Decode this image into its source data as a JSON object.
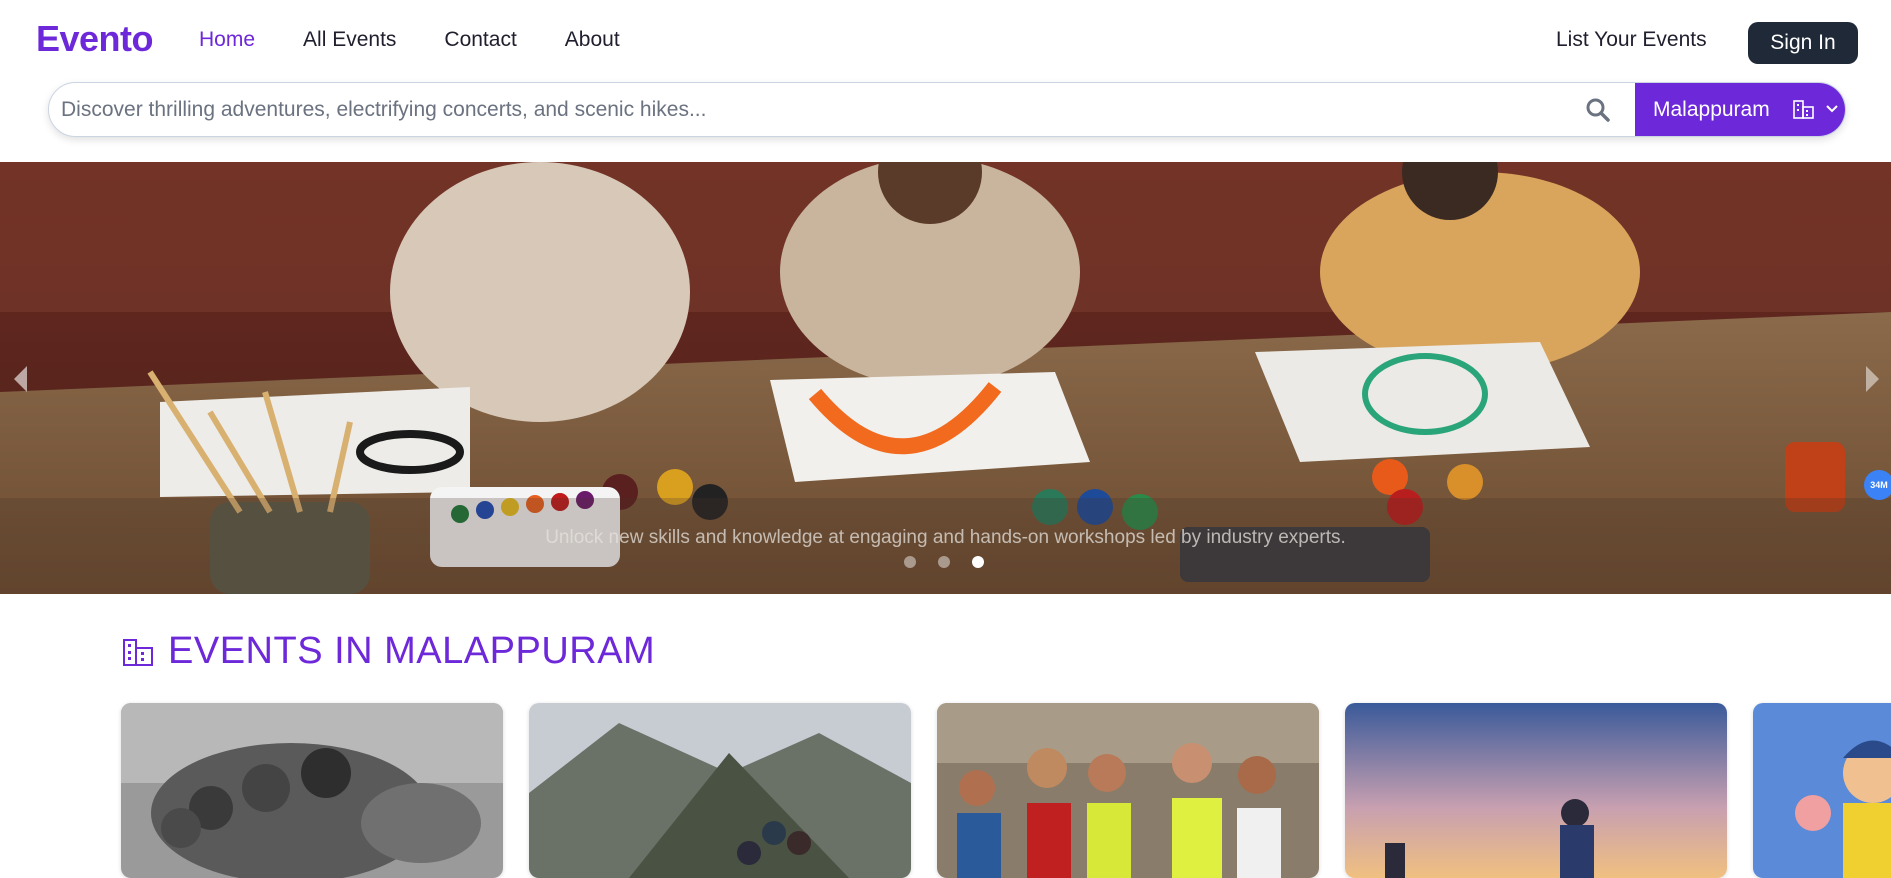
{
  "header": {
    "logo": "Evento",
    "nav": [
      {
        "label": "Home",
        "active": true
      },
      {
        "label": "All Events",
        "active": false
      },
      {
        "label": "Contact",
        "active": false
      },
      {
        "label": "About",
        "active": false
      }
    ],
    "list_events": "List Your Events",
    "sign_in": "Sign In"
  },
  "search": {
    "placeholder": "Discover thrilling adventures, electrifying concerts, and scenic hikes...",
    "value": "",
    "city": "Malappuram"
  },
  "hero": {
    "caption": "Unlock new skills and knowledge at engaging and hands-on workshops led by industry experts.",
    "slide_count": 3,
    "active_slide": 3,
    "badge": "34M"
  },
  "section": {
    "title": "EVENTS IN MALAPPURAM"
  },
  "colors": {
    "brand": "#6d28d9",
    "dark_button": "#1f2937"
  },
  "events": [
    {
      "image": "runners-sprint-bw"
    },
    {
      "image": "mountain-hikers"
    },
    {
      "image": "marathon-runners"
    },
    {
      "image": "sunset-trekker"
    },
    {
      "image": "cartoon-runner"
    }
  ]
}
